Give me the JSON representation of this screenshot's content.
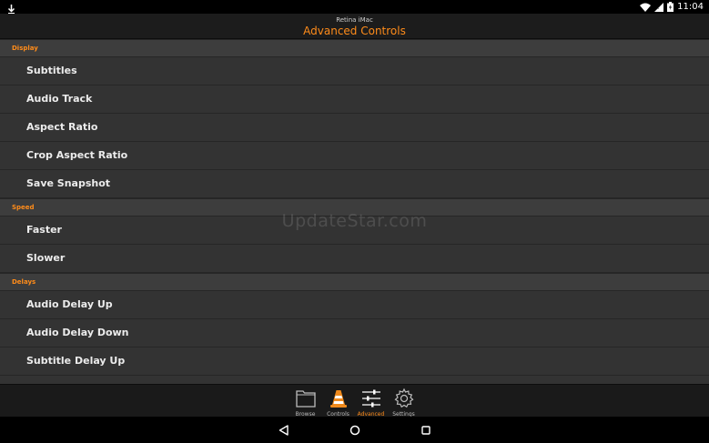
{
  "status_bar": {
    "time": "11:04"
  },
  "header": {
    "subtitle": "Retina iMac",
    "title": "Advanced Controls"
  },
  "sections": [
    {
      "label": "Display",
      "items": [
        "Subtitles",
        "Audio Track",
        "Aspect Ratio",
        "Crop Aspect Ratio",
        "Save Snapshot"
      ]
    },
    {
      "label": "Speed",
      "items": [
        "Faster",
        "Slower"
      ]
    },
    {
      "label": "Delays",
      "items": [
        "Audio Delay Up",
        "Audio Delay Down",
        "Subtitle Delay Up"
      ]
    }
  ],
  "watermark": "UpdateStar.com",
  "tabs": [
    {
      "label": "Browse",
      "icon": "folder-icon"
    },
    {
      "label": "Controls",
      "icon": "vlc-cone-icon"
    },
    {
      "label": "Advanced",
      "icon": "sliders-icon",
      "active": true
    },
    {
      "label": "Settings",
      "icon": "gear-icon"
    }
  ],
  "colors": {
    "accent": "#ff8c1a",
    "background": "#333333"
  }
}
